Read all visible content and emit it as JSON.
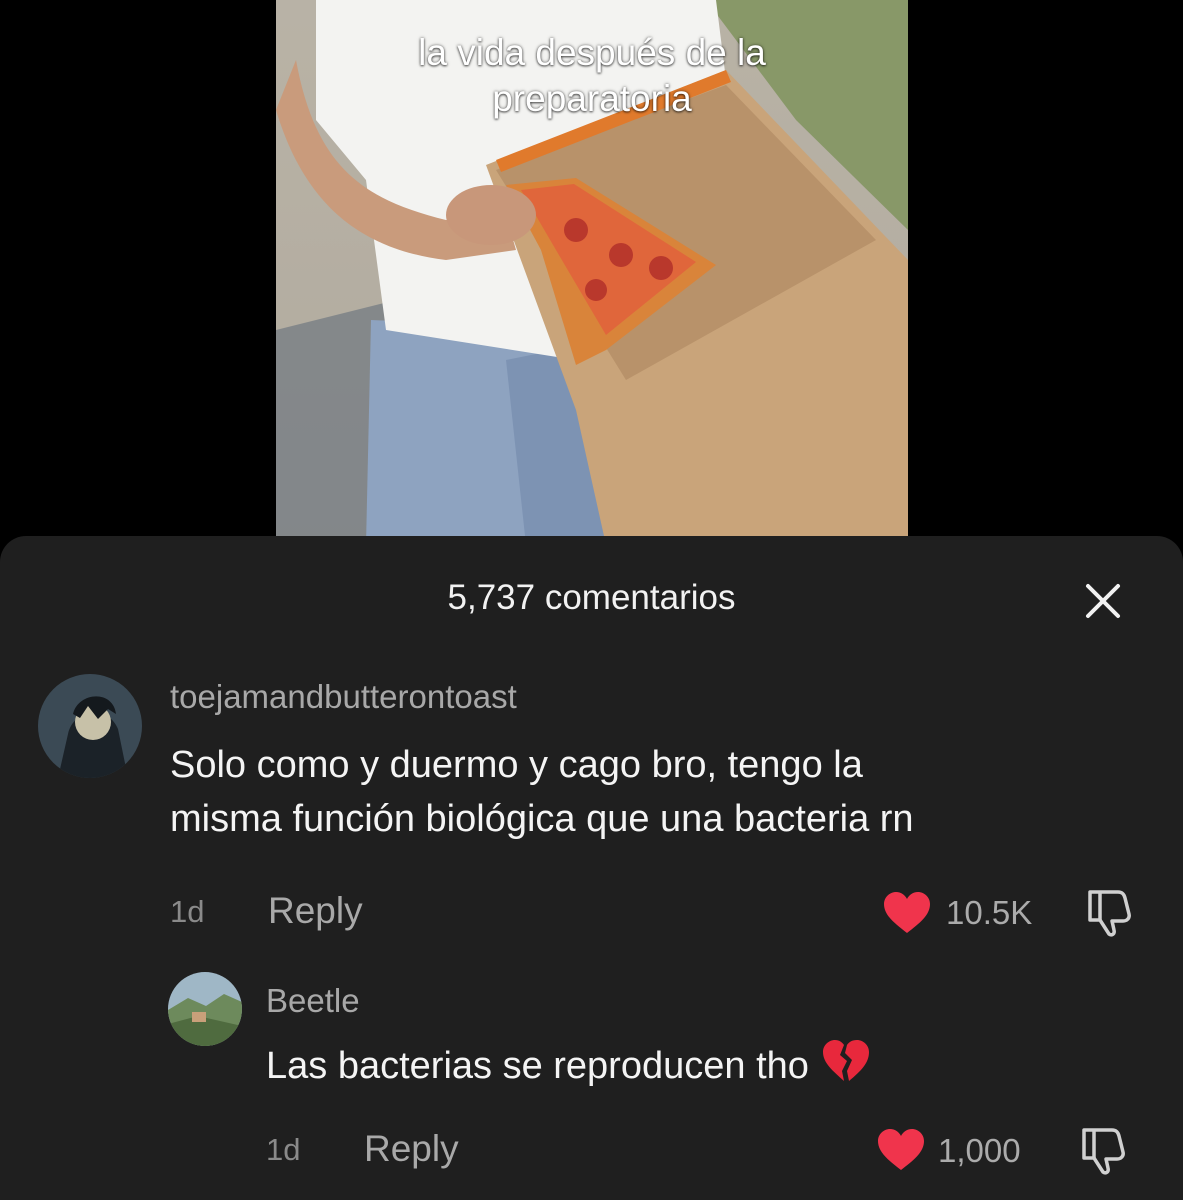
{
  "video": {
    "caption_line1": "la vida después de la",
    "caption_line2": "preparatoria"
  },
  "comments_sheet": {
    "title": "5,737 comentarios",
    "close_icon": "close-icon",
    "comments": [
      {
        "username": "toejamandbutterontoast",
        "text_line1": "Solo como y duermo y cago bro, tengo la",
        "text_line2": "misma función biológica que una bacteria rn",
        "time": "1d",
        "reply_label": "Reply",
        "likes": "10.5K"
      },
      {
        "username": "Beetle",
        "text": "Las bacterias se reproducen tho",
        "emoji": "broken-heart-icon",
        "time": "1d",
        "reply_label": "Reply",
        "likes": "1,000"
      }
    ]
  },
  "colors": {
    "sheet_background": "#1f1f1f",
    "like_heart": "#f0344c",
    "page_background": "#000000"
  }
}
